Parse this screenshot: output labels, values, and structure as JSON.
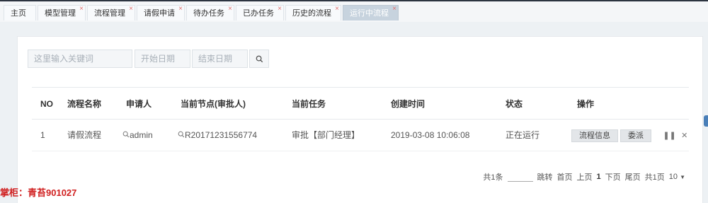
{
  "tabs": [
    {
      "label": "主页",
      "closable": false,
      "active": false
    },
    {
      "label": "模型管理",
      "closable": true,
      "active": false
    },
    {
      "label": "流程管理",
      "closable": true,
      "active": false
    },
    {
      "label": "请假申请",
      "closable": true,
      "active": false
    },
    {
      "label": "待办任务",
      "closable": true,
      "active": false
    },
    {
      "label": "已办任务",
      "closable": true,
      "active": false
    },
    {
      "label": "历史的流程",
      "closable": true,
      "active": false
    },
    {
      "label": "运行中流程",
      "closable": true,
      "active": true
    }
  ],
  "close_glyph": "×",
  "search": {
    "keyword_placeholder": "这里输入关键词",
    "start_date_placeholder": "开始日期",
    "end_date_placeholder": "结束日期"
  },
  "table": {
    "headers": [
      "NO",
      "流程名称",
      "申请人",
      "当前节点(审批人)",
      "当前任务",
      "创建时间",
      "状态",
      "操作"
    ],
    "rows": [
      {
        "no": "1",
        "process_name": "请假流程",
        "applicant": "admin",
        "current_node": "R20171231556774",
        "current_task": "审批【部门经理】",
        "created": "2019-03-08 10:06:08",
        "status": "正在运行",
        "actions": [
          "流程信息",
          "委派"
        ]
      }
    ]
  },
  "pager": {
    "total": "共1条",
    "jump_label": "跳转",
    "first": "首页",
    "prev": "上页",
    "current": "1",
    "next": "下页",
    "last": "尾页",
    "pages": "共1页",
    "page_size": "10"
  },
  "shopkeeper": "掌柜：青苔901027",
  "colors": {
    "status_running": "#4caf50",
    "watermark": "#d02020",
    "close_x": "#e27373"
  }
}
